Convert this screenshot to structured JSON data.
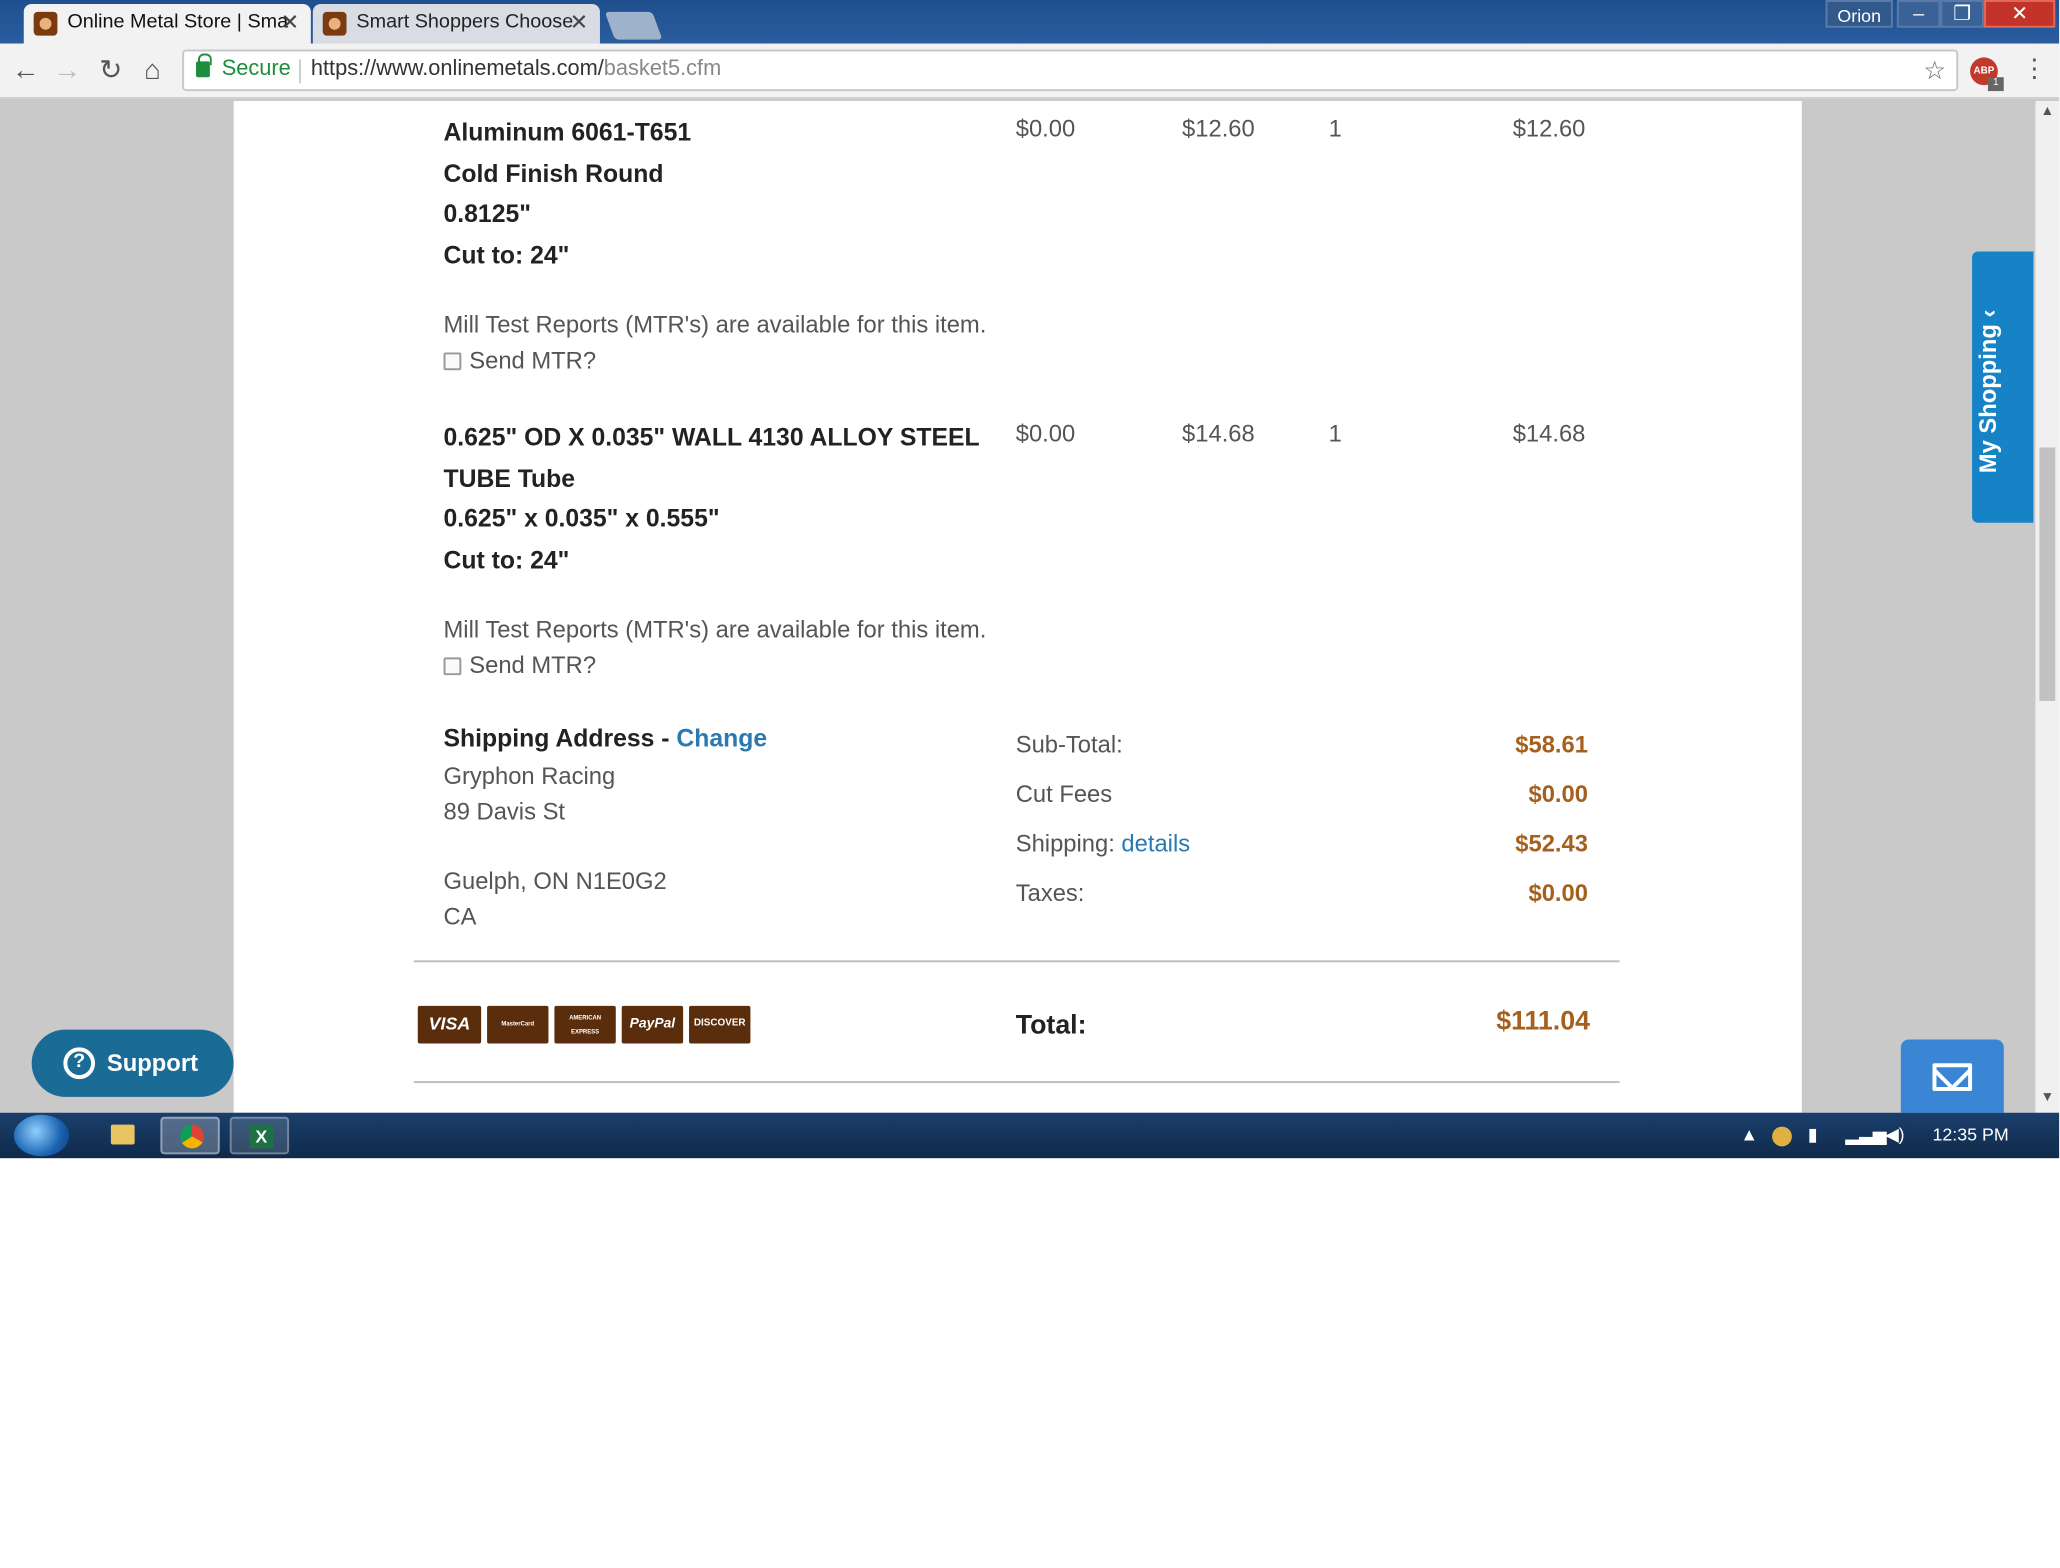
{
  "browser": {
    "tabs": [
      {
        "title": "Online Metal Store | Sma",
        "active": true
      },
      {
        "title": "Smart Shoppers Choose",
        "active": false
      }
    ],
    "window_user": "Orion",
    "secure_label": "Secure",
    "url_host": "https://www.onlinemetals.com/",
    "url_path": "basket5.cfm",
    "ext_badge": "1"
  },
  "cart": {
    "items": [
      {
        "name_lines": [
          "Aluminum 6061-T651",
          "Cold Finish Round",
          "0.8125\"",
          "Cut to: 24\""
        ],
        "cut_fee": "$0.00",
        "unit_price": "$12.60",
        "qty": "1",
        "line_total": "$12.60",
        "mtr_note": "Mill Test Reports (MTR's) are available for this item.",
        "mtr_checkbox": "Send MTR?"
      },
      {
        "name_lines": [
          "0.625\" OD X 0.035\" WALL 4130 ALLOY STEEL",
          "TUBE Tube",
          "0.625\" x 0.035\" x 0.555\"",
          "Cut to: 24\""
        ],
        "cut_fee": "$0.00",
        "unit_price": "$14.68",
        "qty": "1",
        "line_total": "$14.68",
        "mtr_note": "Mill Test Reports (MTR's) are available for this item.",
        "mtr_checkbox": "Send MTR?"
      }
    ],
    "shipping": {
      "title": "Shipping Address - ",
      "change_link": "Change",
      "lines": [
        "Gryphon Racing",
        "89 Davis St",
        "",
        "Guelph, ON N1E0G2",
        "CA"
      ]
    },
    "summary": {
      "subtotal_label": "Sub-Total:",
      "subtotal": "$58.61",
      "cut_fees_label": "Cut Fees",
      "cut_fees": "$0.00",
      "shipping_label": "Shipping: ",
      "shipping_details_link": "details",
      "shipping": "$52.43",
      "taxes_label": "Taxes:",
      "taxes": "$0.00",
      "total_label": "Total:",
      "total": "$111.04"
    },
    "payment_cards": [
      "VISA",
      "MasterCard",
      "AMERICAN EXPRESS",
      "PayPal",
      "DISCOVER"
    ]
  },
  "widgets": {
    "my_shopping": "My Shopping",
    "support": "Support"
  },
  "taskbar": {
    "clock": "12:35 PM"
  },
  "colors": {
    "accent_price": "#a5601d",
    "link": "#2a7ab0",
    "my_shopping_tab": "#1583c6",
    "support_button": "#1a6b96"
  }
}
